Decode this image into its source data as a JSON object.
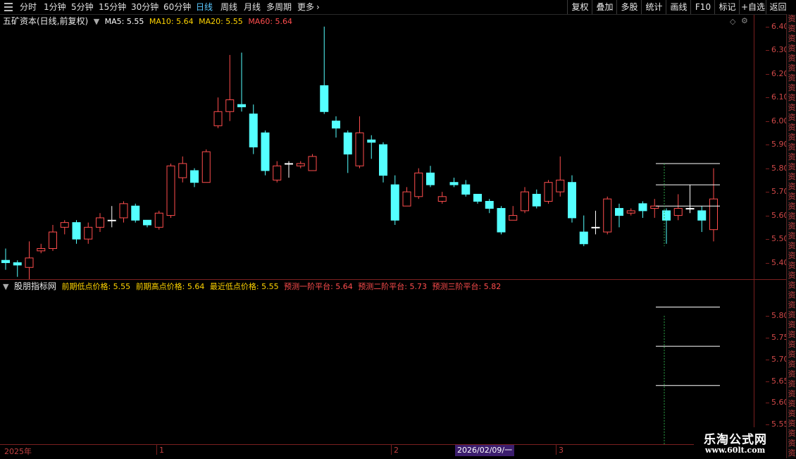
{
  "tabs": [
    {
      "label": "分时",
      "active": false
    },
    {
      "label": "1分钟",
      "active": false
    },
    {
      "label": "5分钟",
      "active": false
    },
    {
      "label": "15分钟",
      "active": false
    },
    {
      "label": "30分钟",
      "active": false
    },
    {
      "label": "60分钟",
      "active": false
    },
    {
      "label": "日线",
      "active": true
    },
    {
      "label": "周线",
      "active": false
    },
    {
      "label": "月线",
      "active": false
    },
    {
      "label": "多周期",
      "active": false
    },
    {
      "label": "更多",
      "active": false
    }
  ],
  "right_buttons": [
    "复权",
    "叠加",
    "多股",
    "统计",
    "画线",
    "F10",
    "标记",
    "+自选",
    "返回"
  ],
  "main_header": {
    "name": "五矿资本(日线,前复权)",
    "ma5": "MA5: 5.55",
    "ma10": "MA10: 5.64",
    "ma20": "MA20: 5.55",
    "ma60": "MA60: 5.64"
  },
  "main_axis": [
    "6.40",
    "6.30",
    "6.20",
    "6.10",
    "6.00",
    "5.90",
    "5.80",
    "5.70",
    "5.60",
    "5.50",
    "5.40"
  ],
  "sub_header": {
    "name": "股朋指标网",
    "prev_low": "前期低点价格: 5.55",
    "prev_high": "前期高点价格: 5.64",
    "recent_low": "最近低点价格: 5.55",
    "p1": "预测一阶平台: 5.64",
    "p2": "预测二阶平台: 5.73",
    "p3": "预测三阶平台: 5.82"
  },
  "sub_axis": [
    "5.80",
    "5.75",
    "5.70",
    "5.65",
    "5.60",
    "5.55"
  ],
  "dates": {
    "year": "2025年",
    "m1": "1",
    "m2": "2",
    "m3": "3",
    "cursor": "2026/02/09/一"
  },
  "side_glyphs": [
    "资",
    "资",
    "资",
    "资",
    "资",
    "资",
    "资",
    "资",
    "资",
    "资",
    "资",
    "资",
    "资",
    "资",
    "资",
    "资",
    "资",
    "资",
    "资",
    "资",
    "资",
    "资",
    "资",
    "资",
    "资",
    "资",
    "资",
    "资",
    "资",
    "资",
    "资",
    "资",
    "资",
    "资",
    "资",
    "资",
    "资",
    "资",
    "资",
    "资",
    "资",
    "资",
    "资",
    "资",
    "资"
  ],
  "watermark": {
    "line1": "乐淘公式网",
    "line2": "www.60lt.com"
  },
  "colors": {
    "up": "#ff4d4d",
    "down": "#54ffff",
    "flat": "#ffffff",
    "axis": "#7a1f1f"
  },
  "chart_data": {
    "type": "candlestick",
    "ylim": [
      5.33,
      6.45
    ],
    "candles": [
      [
        5.41,
        5.4,
        5.46,
        5.37
      ],
      [
        5.4,
        5.39,
        5.41,
        5.34
      ],
      [
        5.38,
        5.42,
        5.49,
        5.33
      ],
      [
        5.45,
        5.46,
        5.48,
        5.44
      ],
      [
        5.46,
        5.53,
        5.56,
        5.45
      ],
      [
        5.55,
        5.57,
        5.58,
        5.52
      ],
      [
        5.57,
        5.5,
        5.58,
        5.48
      ],
      [
        5.5,
        5.55,
        5.57,
        5.48
      ],
      [
        5.55,
        5.59,
        5.61,
        5.53
      ],
      [
        5.58,
        5.58,
        5.64,
        5.55
      ],
      [
        5.59,
        5.65,
        5.66,
        5.57
      ],
      [
        5.64,
        5.58,
        5.65,
        5.57
      ],
      [
        5.58,
        5.56,
        5.58,
        5.55
      ],
      [
        5.55,
        5.61,
        5.62,
        5.54
      ],
      [
        5.6,
        5.81,
        5.82,
        5.59
      ],
      [
        5.76,
        5.82,
        5.85,
        5.74
      ],
      [
        5.79,
        5.74,
        5.8,
        5.72
      ],
      [
        5.74,
        5.87,
        5.88,
        5.74
      ],
      [
        5.98,
        6.04,
        6.1,
        5.97
      ],
      [
        6.04,
        6.09,
        6.28,
        6.0
      ],
      [
        6.07,
        6.06,
        6.29,
        6.04
      ],
      [
        6.03,
        5.89,
        6.07,
        5.86
      ],
      [
        5.95,
        5.79,
        5.96,
        5.77
      ],
      [
        5.75,
        5.81,
        5.83,
        5.74
      ],
      [
        5.82,
        5.82,
        5.83,
        5.76
      ],
      [
        5.81,
        5.82,
        5.83,
        5.8
      ],
      [
        5.79,
        5.85,
        5.86,
        5.79
      ],
      [
        6.15,
        6.04,
        6.4,
        6.03
      ],
      [
        6.0,
        5.97,
        6.02,
        5.93
      ],
      [
        5.95,
        5.86,
        5.96,
        5.78
      ],
      [
        5.81,
        5.95,
        6.02,
        5.8
      ],
      [
        5.92,
        5.91,
        5.94,
        5.84
      ],
      [
        5.9,
        5.77,
        5.91,
        5.74
      ],
      [
        5.73,
        5.58,
        5.77,
        5.56
      ],
      [
        5.64,
        5.7,
        5.72,
        5.64
      ],
      [
        5.68,
        5.78,
        5.8,
        5.67
      ],
      [
        5.78,
        5.73,
        5.81,
        5.72
      ],
      [
        5.66,
        5.68,
        5.7,
        5.65
      ],
      [
        5.74,
        5.73,
        5.76,
        5.72
      ],
      [
        5.73,
        5.69,
        5.75,
        5.68
      ],
      [
        5.69,
        5.66,
        5.69,
        5.65
      ],
      [
        5.66,
        5.63,
        5.67,
        5.61
      ],
      [
        5.63,
        5.53,
        5.64,
        5.52
      ],
      [
        5.58,
        5.6,
        5.64,
        5.58
      ],
      [
        5.62,
        5.7,
        5.72,
        5.61
      ],
      [
        5.69,
        5.64,
        5.71,
        5.63
      ],
      [
        5.66,
        5.74,
        5.75,
        5.65
      ],
      [
        5.7,
        5.75,
        5.85,
        5.68
      ],
      [
        5.74,
        5.59,
        5.77,
        5.57
      ],
      [
        5.53,
        5.48,
        5.6,
        5.47
      ],
      [
        5.55,
        5.55,
        5.62,
        5.52
      ],
      [
        5.53,
        5.67,
        5.68,
        5.52
      ],
      [
        5.63,
        5.6,
        5.65,
        5.55
      ],
      [
        5.61,
        5.62,
        5.63,
        5.6
      ],
      [
        5.65,
        5.62,
        5.66,
        5.59
      ],
      [
        5.63,
        5.64,
        5.67,
        5.59
      ],
      [
        5.62,
        5.58,
        5.63,
        5.48
      ],
      [
        5.6,
        5.63,
        5.69,
        5.58
      ],
      [
        5.63,
        5.63,
        5.73,
        5.61
      ],
      [
        5.62,
        5.58,
        5.64,
        5.53
      ],
      [
        5.54,
        5.67,
        5.8,
        5.49
      ]
    ],
    "platforms_main": [
      5.82,
      5.73,
      5.64
    ],
    "sub_levels": [
      5.82,
      5.73,
      5.64
    ],
    "sub_ylim": [
      5.51,
      5.85
    ]
  }
}
